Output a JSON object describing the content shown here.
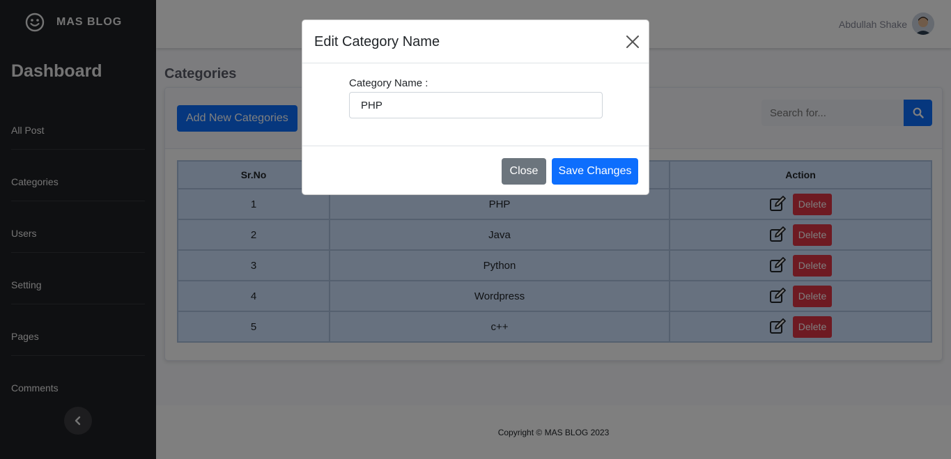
{
  "brand": {
    "name": "MAS BLOG",
    "icon": "smile-icon"
  },
  "sidebar": {
    "title": "Dashboard",
    "items": [
      {
        "label": "All Post"
      },
      {
        "label": "Categories"
      },
      {
        "label": "Users"
      },
      {
        "label": "Setting"
      },
      {
        "label": "Pages"
      },
      {
        "label": "Comments"
      }
    ],
    "collapse_icon": "chevron-left-icon"
  },
  "topbar": {
    "user_name": "Abdullah Shake",
    "avatar_icon": "user-avatar"
  },
  "page": {
    "heading": "Categories"
  },
  "toolbar": {
    "add_label": "Add New Categories",
    "search_placeholder": "Search for...",
    "search_icon": "search-icon"
  },
  "table": {
    "headers": {
      "sr": "Sr.No",
      "name": "",
      "action": "Action"
    },
    "rows": [
      {
        "sr": "1",
        "name": "PHP",
        "delete_label": "Delete"
      },
      {
        "sr": "2",
        "name": "Java",
        "delete_label": "Delete"
      },
      {
        "sr": "3",
        "name": "Python",
        "delete_label": "Delete"
      },
      {
        "sr": "4",
        "name": "Wordpress",
        "delete_label": "Delete"
      },
      {
        "sr": "5",
        "name": "c++",
        "delete_label": "Delete"
      }
    ]
  },
  "footer": {
    "text": "Copyright © MAS BLOG 2023"
  },
  "modal": {
    "title": "Edit Category Name",
    "field_label": "Category Name :",
    "field_value": "PHP",
    "close_label": "Close",
    "save_label": "Save Changes"
  },
  "colors": {
    "primary": "#0d6efd",
    "danger": "#dc3545",
    "secondary": "#6c757d",
    "sidebar": "#1f2024",
    "table_row": "#cfe2ff"
  }
}
